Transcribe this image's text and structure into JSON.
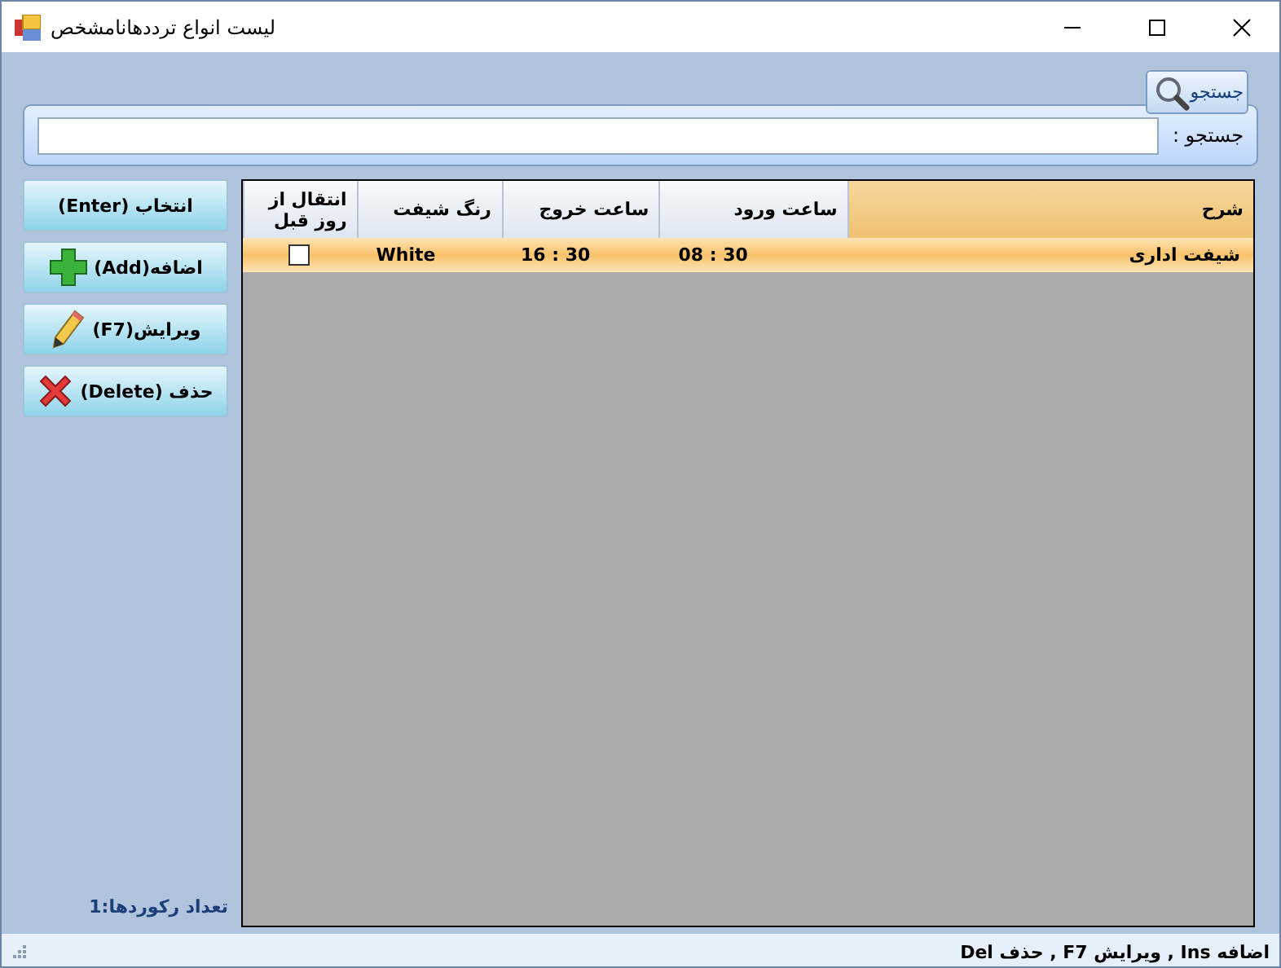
{
  "window": {
    "title": "لیست انواع ترددهانامشخص"
  },
  "search": {
    "button": "جستجو",
    "label": "جستجو :"
  },
  "actions": [
    {
      "label": "انتخاب (Enter)",
      "kind": "plain"
    },
    {
      "label": "اضافه(Add)",
      "kind": "add"
    },
    {
      "label": "ویرایش(F7)",
      "kind": "edit"
    },
    {
      "label": "حذف (Delete)",
      "kind": "delete"
    }
  ],
  "table": {
    "columns": [
      {
        "label": "شرح",
        "sorted": true
      },
      {
        "label": "ساعت ورود",
        "sorted": false
      },
      {
        "label": "ساعت خروج",
        "sorted": false
      },
      {
        "label": "رنگ شیفت",
        "sorted": false
      },
      {
        "label": "انتقال از روز قبل",
        "sorted": false
      }
    ],
    "rows": [
      {
        "selected": true,
        "cells": [
          "شیفت اداری",
          "08 : 30",
          "16 : 30",
          "White"
        ],
        "carry_over": false
      }
    ]
  },
  "record_count": "تعداد رکوردها:1",
  "status_bar": "اضافه Ins , ویرایش F7 , حذف Del"
}
